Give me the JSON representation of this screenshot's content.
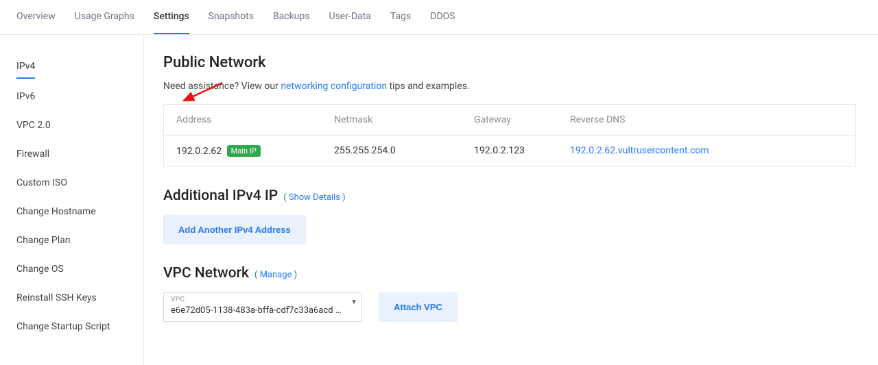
{
  "topnav": {
    "items": [
      {
        "label": "Overview"
      },
      {
        "label": "Usage Graphs"
      },
      {
        "label": "Settings",
        "active": true
      },
      {
        "label": "Snapshots"
      },
      {
        "label": "Backups"
      },
      {
        "label": "User-Data"
      },
      {
        "label": "Tags"
      },
      {
        "label": "DDOS"
      }
    ]
  },
  "sidebar": {
    "items": [
      {
        "label": "IPv4",
        "active": true
      },
      {
        "label": "IPv6"
      },
      {
        "label": "VPC 2.0"
      },
      {
        "label": "Firewall"
      },
      {
        "label": "Custom ISO"
      },
      {
        "label": "Change Hostname"
      },
      {
        "label": "Change Plan"
      },
      {
        "label": "Change OS"
      },
      {
        "label": "Reinstall SSH Keys"
      },
      {
        "label": "Change Startup Script"
      }
    ]
  },
  "public_network": {
    "title": "Public Network",
    "assist_prefix": "Need assistance? View our ",
    "assist_link": "networking configuration",
    "assist_suffix": " tips and examples.",
    "headers": {
      "address": "Address",
      "netmask": "Netmask",
      "gateway": "Gateway",
      "rdns": "Reverse DNS"
    },
    "row": {
      "address": "192.0.2.62",
      "badge": "Main IP",
      "netmask": "255.255.254.0",
      "gateway": "192.0.2.123",
      "rdns": "192.0.2.62.vultrusercontent.com"
    }
  },
  "additional": {
    "title": "Additional IPv4 IP",
    "show_details": "( Show Details )",
    "add_button": "Add Another IPv4 Address"
  },
  "vpc": {
    "title": "VPC Network",
    "manage": "( Manage )",
    "float_label": "VPC",
    "selected": "e6e72d05-1138-483a-bffa-cdf7c33a6acd - …",
    "attach_button": "Attach VPC"
  }
}
